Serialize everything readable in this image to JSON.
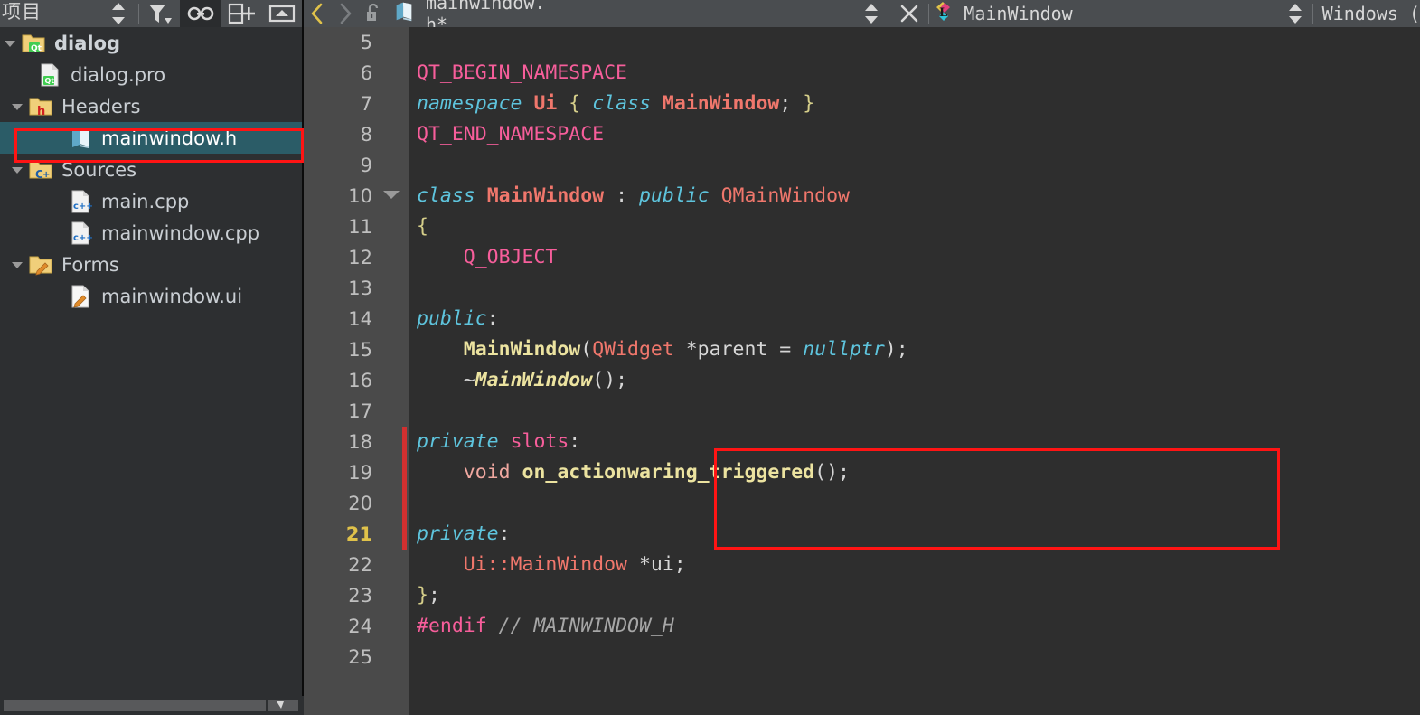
{
  "sidebar": {
    "title": "项目",
    "toolbar": [
      {
        "name": "sort-updown-icon",
        "label": "",
        "active": false
      },
      {
        "name": "filter-icon",
        "label": "",
        "active": false
      },
      {
        "name": "link-icon",
        "label": "",
        "active": true
      },
      {
        "name": "add-split-icon",
        "label": "",
        "active": false
      },
      {
        "name": "collapse-icon",
        "label": "",
        "active": false
      }
    ],
    "tree": [
      {
        "label": "dialog",
        "icon": "qt-folder-icon",
        "indent": 1,
        "expanded": true,
        "bold": true,
        "selected": false
      },
      {
        "label": "dialog.pro",
        "icon": "qt-pro-file-icon",
        "indent": 2,
        "expanded": null,
        "bold": false,
        "selected": false
      },
      {
        "label": "Headers",
        "icon": "headers-folder-icon",
        "indent": 2,
        "expanded": true,
        "bold": false,
        "selected": false
      },
      {
        "label": "mainwindow.h",
        "icon": "header-file-icon",
        "indent": 3,
        "expanded": null,
        "bold": false,
        "selected": true
      },
      {
        "label": "Sources",
        "icon": "sources-folder-icon",
        "indent": 2,
        "expanded": true,
        "bold": false,
        "selected": false
      },
      {
        "label": "main.cpp",
        "icon": "cpp-file-icon",
        "indent": 3,
        "expanded": null,
        "bold": false,
        "selected": false
      },
      {
        "label": "mainwindow.cpp",
        "icon": "cpp-file-icon",
        "indent": 3,
        "expanded": null,
        "bold": false,
        "selected": false
      },
      {
        "label": "Forms",
        "icon": "forms-folder-icon",
        "indent": 2,
        "expanded": true,
        "bold": false,
        "selected": false
      },
      {
        "label": "mainwindow.ui",
        "icon": "ui-file-icon",
        "indent": 3,
        "expanded": null,
        "bold": false,
        "selected": false
      }
    ]
  },
  "editor": {
    "nav": {
      "back_icon": "chevron-left-icon",
      "forward_icon": "chevron-right-icon",
      "lock_icon": "unlock-icon"
    },
    "file_icon": "header-file-icon",
    "filename": "mainwindow. h*",
    "close_icon": "close-icon",
    "updown_icon": "updown-arrows-icon",
    "symbol_icon": "qt-class-icon",
    "symbol": "MainWindow",
    "scope": "Windows ("
  },
  "code": {
    "first_line": 5,
    "cursor_line": 21,
    "lines": [
      {
        "num": 5,
        "fold": false,
        "changed": false,
        "tokens": []
      },
      {
        "num": 6,
        "fold": false,
        "changed": false,
        "tokens": [
          {
            "t": "QT_BEGIN_NAMESPACE",
            "c": "macro"
          }
        ]
      },
      {
        "num": 7,
        "fold": false,
        "changed": false,
        "tokens": [
          {
            "t": "namespace",
            "c": "kw"
          },
          {
            "t": " ",
            "c": "plain"
          },
          {
            "t": "Ui",
            "c": "type"
          },
          {
            "t": " ",
            "c": "plain"
          },
          {
            "t": "{",
            "c": "brace"
          },
          {
            "t": " ",
            "c": "plain"
          },
          {
            "t": "class",
            "c": "kw"
          },
          {
            "t": " ",
            "c": "plain"
          },
          {
            "t": "MainWindow",
            "c": "type"
          },
          {
            "t": ";",
            "c": "punct"
          },
          {
            "t": " ",
            "c": "plain"
          },
          {
            "t": "}",
            "c": "brace"
          }
        ]
      },
      {
        "num": 8,
        "fold": false,
        "changed": false,
        "tokens": [
          {
            "t": "QT_END_NAMESPACE",
            "c": "macro"
          }
        ]
      },
      {
        "num": 9,
        "fold": false,
        "changed": false,
        "tokens": []
      },
      {
        "num": 10,
        "fold": true,
        "changed": false,
        "tokens": [
          {
            "t": "class",
            "c": "kw"
          },
          {
            "t": " ",
            "c": "plain"
          },
          {
            "t": "MainWindow",
            "c": "type"
          },
          {
            "t": " : ",
            "c": "punct"
          },
          {
            "t": "public",
            "c": "kw"
          },
          {
            "t": " ",
            "c": "plain"
          },
          {
            "t": "QMainWindow",
            "c": "typeplain"
          }
        ]
      },
      {
        "num": 11,
        "fold": false,
        "changed": false,
        "tokens": [
          {
            "t": "{",
            "c": "brace"
          }
        ]
      },
      {
        "num": 12,
        "fold": false,
        "changed": false,
        "tokens": [
          {
            "t": "    ",
            "c": "plain"
          },
          {
            "t": "Q_OBJECT",
            "c": "macro"
          }
        ]
      },
      {
        "num": 13,
        "fold": false,
        "changed": false,
        "tokens": []
      },
      {
        "num": 14,
        "fold": false,
        "changed": false,
        "tokens": [
          {
            "t": "public",
            "c": "kw"
          },
          {
            "t": ":",
            "c": "punct"
          }
        ]
      },
      {
        "num": 15,
        "fold": false,
        "changed": false,
        "tokens": [
          {
            "t": "    ",
            "c": "plain"
          },
          {
            "t": "MainWindow",
            "c": "fn"
          },
          {
            "t": "(",
            "c": "punct"
          },
          {
            "t": "QWidget",
            "c": "typeplain"
          },
          {
            "t": " *parent = ",
            "c": "plain"
          },
          {
            "t": "nullptr",
            "c": "kw"
          },
          {
            "t": ");",
            "c": "punct"
          }
        ]
      },
      {
        "num": 16,
        "fold": false,
        "changed": false,
        "tokens": [
          {
            "t": "    ~",
            "c": "plain"
          },
          {
            "t": "MainWindow",
            "c": "fni"
          },
          {
            "t": "();",
            "c": "punct"
          }
        ]
      },
      {
        "num": 17,
        "fold": false,
        "changed": false,
        "tokens": []
      },
      {
        "num": 18,
        "fold": false,
        "changed": true,
        "tokens": [
          {
            "t": "private",
            "c": "kw"
          },
          {
            "t": " ",
            "c": "plain"
          },
          {
            "t": "slots",
            "c": "macro"
          },
          {
            "t": ":",
            "c": "punct"
          }
        ]
      },
      {
        "num": 19,
        "fold": false,
        "changed": true,
        "tokens": [
          {
            "t": "    ",
            "c": "plain"
          },
          {
            "t": "void",
            "c": "vd"
          },
          {
            "t": " ",
            "c": "plain"
          },
          {
            "t": "on_actionwaring_triggered",
            "c": "fn"
          },
          {
            "t": "();",
            "c": "punct"
          }
        ]
      },
      {
        "num": 20,
        "fold": false,
        "changed": true,
        "tokens": []
      },
      {
        "num": 21,
        "fold": false,
        "changed": true,
        "tokens": [
          {
            "t": "private",
            "c": "kw"
          },
          {
            "t": ":",
            "c": "punct"
          }
        ]
      },
      {
        "num": 22,
        "fold": false,
        "changed": false,
        "tokens": [
          {
            "t": "    ",
            "c": "plain"
          },
          {
            "t": "Ui::MainWindow",
            "c": "typeplain"
          },
          {
            "t": " *ui;",
            "c": "plain"
          }
        ]
      },
      {
        "num": 23,
        "fold": false,
        "changed": false,
        "tokens": [
          {
            "t": "}",
            "c": "brace"
          },
          {
            "t": ";",
            "c": "punct"
          }
        ]
      },
      {
        "num": 24,
        "fold": false,
        "changed": false,
        "tokens": [
          {
            "t": "#endif",
            "c": "pp"
          },
          {
            "t": " ",
            "c": "plain"
          },
          {
            "t": "// MAINWINDOW_H",
            "c": "cmt"
          }
        ]
      },
      {
        "num": 25,
        "fold": false,
        "changed": false,
        "tokens": []
      }
    ]
  },
  "annotations": {
    "file_box_color": "#ff1414",
    "code_box_color": "#ff1414"
  },
  "colors": {
    "selection": "#2b5c67",
    "toolbar": "#4a4d50",
    "gutter": "#4a4a4a",
    "code_bg": "#2e2e2e",
    "sidebar_bg": "#2d2f31",
    "change_bar": "#d13030",
    "cursor_line_num": "#e0c24a"
  }
}
